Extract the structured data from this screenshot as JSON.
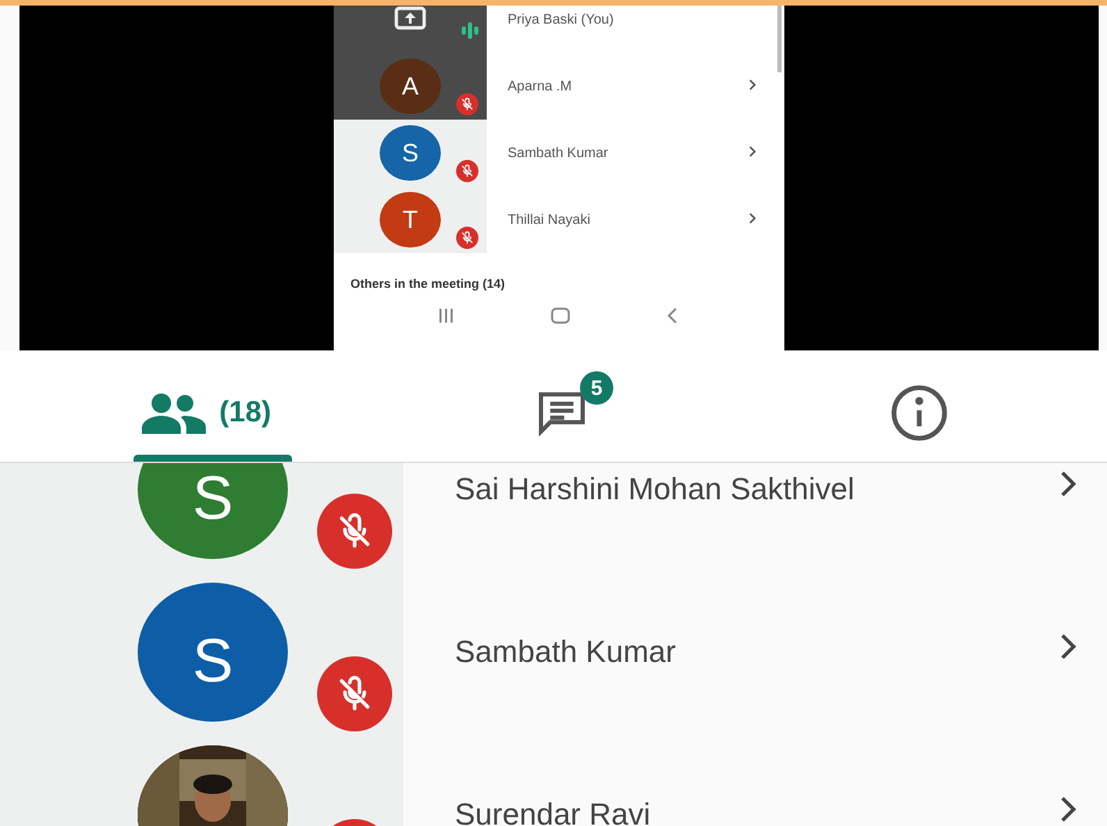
{
  "shared_screen": {
    "participants": [
      {
        "name": "Priya Baski (You)",
        "kind": "self",
        "muted": false,
        "dimmed": true
      },
      {
        "name": "Aparna .M",
        "kind": "participant",
        "muted": true,
        "dimmed": true,
        "avatar": {
          "letter": "A",
          "color": "#5a2e14"
        }
      },
      {
        "name": "Sambath Kumar",
        "kind": "participant",
        "muted": true,
        "dimmed": false,
        "avatar": {
          "letter": "S",
          "color": "#1565a8"
        }
      },
      {
        "name": "Thillai Nayaki",
        "kind": "participant",
        "muted": true,
        "dimmed": false,
        "avatar": {
          "letter": "T",
          "color": "#c23b12"
        }
      }
    ],
    "section_label": "Others in the meeting (14)"
  },
  "tabs": [
    {
      "kind": "people",
      "label": "(18)",
      "selected": true
    },
    {
      "kind": "chat",
      "badge": "5",
      "selected": false
    },
    {
      "kind": "info",
      "selected": false
    }
  ],
  "participants": [
    {
      "name": "Sai Harshini Mohan Sakthivel",
      "muted": true,
      "avatar": {
        "letter": "S",
        "color": "#2e7d32"
      }
    },
    {
      "name": "Sambath Kumar",
      "muted": true,
      "avatar": {
        "letter": "S",
        "color": "#0d5ea6"
      }
    },
    {
      "name": "Surendar Ravi",
      "muted": true
    }
  ]
}
